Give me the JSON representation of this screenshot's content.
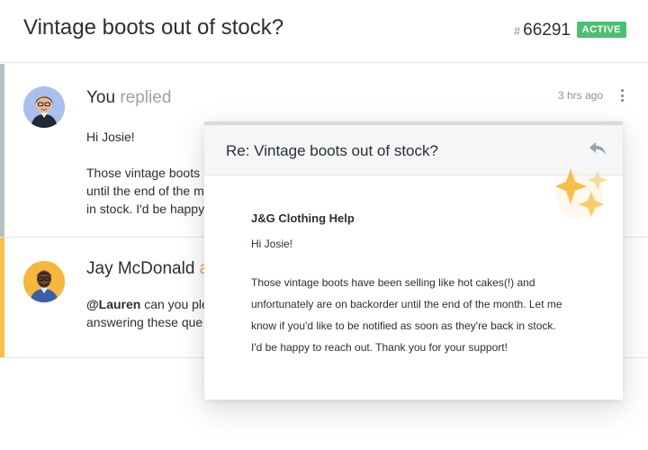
{
  "header": {
    "title": "Vintage boots out of stock?",
    "ticket_hash": "#",
    "ticket_number": "66291",
    "status_badge": "ACTIVE"
  },
  "thread": {
    "messages": [
      {
        "author": "You",
        "action": "replied",
        "time": "3 hrs ago",
        "greeting": "Hi Josie!",
        "lines": [
          "Those vintage boots",
          "until the end of the m",
          "in stock. I'd be happy"
        ]
      },
      {
        "author": "Jay McDonald",
        "action": "a",
        "mention": "@Lauren",
        "lines_after_mention": " can you ple",
        "line2": "answering these que"
      }
    ]
  },
  "email_card": {
    "subject": "Re: Vintage boots out of stock?",
    "brand": "J&G Clothing Help",
    "greeting": "Hi Josie!",
    "lines": [
      "Those vintage boots have been selling like hot cakes(!) and",
      "unfortunately are on backorder until the end of the month. Let me",
      "know if you'd like to be notified as soon as they're back in stock.",
      "I'd be happy to reach out. Thank you for your support!"
    ]
  },
  "icons": {
    "reply": "reply-icon",
    "more": "kebab-menu-icon",
    "sparkles": "sparkles-icon"
  },
  "colors": {
    "status_green": "#4bbf73",
    "bar_grey": "#b6bfc6",
    "bar_yellow": "#f7c046",
    "sparkle": "#f7c046"
  }
}
